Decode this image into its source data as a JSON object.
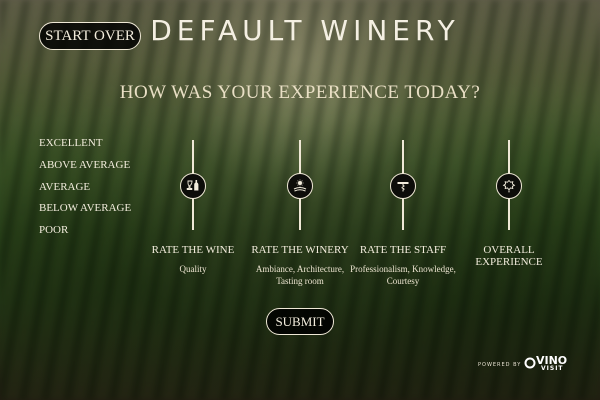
{
  "header": {
    "start_over_label": "START OVER",
    "title": "DEFAULT WINERY"
  },
  "question": "HOW WAS YOUR EXPERIENCE TODAY?",
  "scale": {
    "levels": [
      "EXCELLENT",
      "ABOVE AVERAGE",
      "AVERAGE",
      "BELOW AVERAGE",
      "POOR"
    ]
  },
  "ratings": [
    {
      "label": "RATE THE WINE",
      "sub": [
        "Quality"
      ],
      "icon": "wine-glass-bottle-icon",
      "level": "AVERAGE"
    },
    {
      "label": "RATE THE WINERY",
      "sub": [
        "Ambiance, Architecture,",
        "Tasting room"
      ],
      "icon": "winery-landscape-icon",
      "level": "AVERAGE"
    },
    {
      "label": "RATE THE STAFF",
      "sub": [
        "Professionalism, Knowledge,",
        "Courtesy"
      ],
      "icon": "corkscrew-icon",
      "level": "AVERAGE"
    },
    {
      "label": "OVERALL",
      "label2": "EXPERIENCE",
      "sub": [],
      "icon": "grape-leaf-icon",
      "level": "AVERAGE"
    }
  ],
  "submit_label": "SUBMIT",
  "footer": {
    "powered_by": "POWERED BY",
    "logo_word": "VINO",
    "logo_word2": "VISIT"
  },
  "colors": {
    "ink": "#f2ecdc",
    "button_bg": "#000000"
  }
}
